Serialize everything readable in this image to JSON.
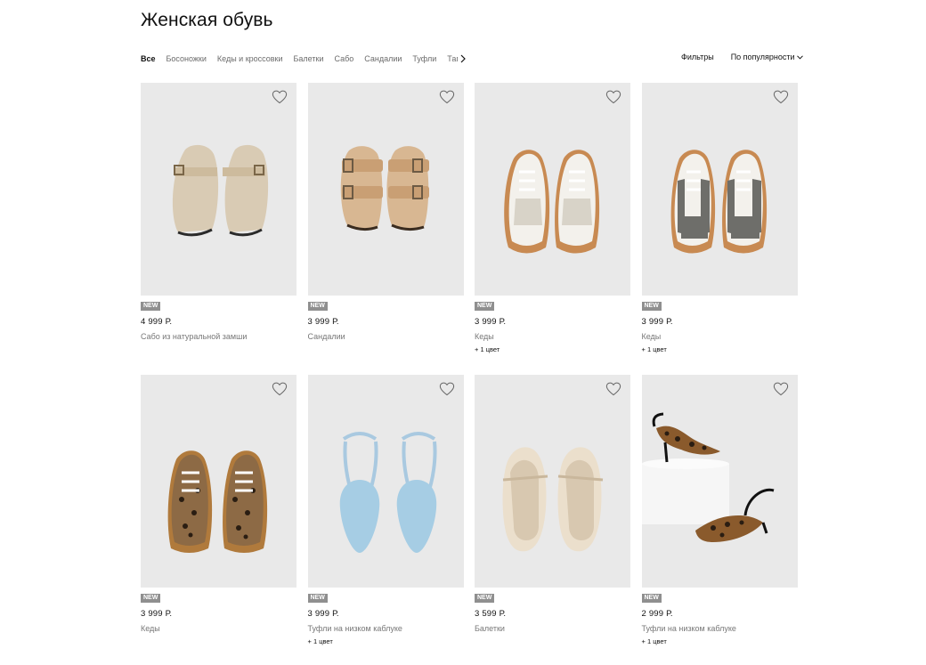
{
  "page": {
    "title": "Женская обувь"
  },
  "categories": [
    "Все",
    "Босоножки",
    "Кеды и кроссовки",
    "Балетки",
    "Сабо",
    "Сандалии",
    "Туфли",
    "Тапочки"
  ],
  "toolbar": {
    "filters_label": "Фильтры",
    "sort_label": "По популярности"
  },
  "icons": {
    "favorite": "heart-icon",
    "scroll": "chevron-right-icon",
    "sort": "chevron-down-icon"
  },
  "colors": {
    "card_bg": "#e9e9e9",
    "badge_bg": "#8f8f8f",
    "text_secondary": "#777777"
  },
  "products": [
    {
      "badge": "NEW",
      "price": "4 999 Р.",
      "name": "Сабо из натуральной замши",
      "colors": ""
    },
    {
      "badge": "NEW",
      "price": "3 999 Р.",
      "name": "Сандалии",
      "colors": ""
    },
    {
      "badge": "NEW",
      "price": "3 999 Р.",
      "name": "Кеды",
      "colors": "+ 1 цвет"
    },
    {
      "badge": "NEW",
      "price": "3 999 Р.",
      "name": "Кеды",
      "colors": "+ 1 цвет"
    },
    {
      "badge": "NEW",
      "price": "3 999 Р.",
      "name": "Кеды",
      "colors": ""
    },
    {
      "badge": "NEW",
      "price": "3 999 Р.",
      "name": "Туфли на низком каблуке",
      "colors": "+ 1 цвет"
    },
    {
      "badge": "NEW",
      "price": "3 599 Р.",
      "name": "Балетки",
      "colors": ""
    },
    {
      "badge": "NEW",
      "price": "2 999 Р.",
      "name": "Туфли на низком каблуке",
      "colors": "+ 1 цвет"
    }
  ]
}
